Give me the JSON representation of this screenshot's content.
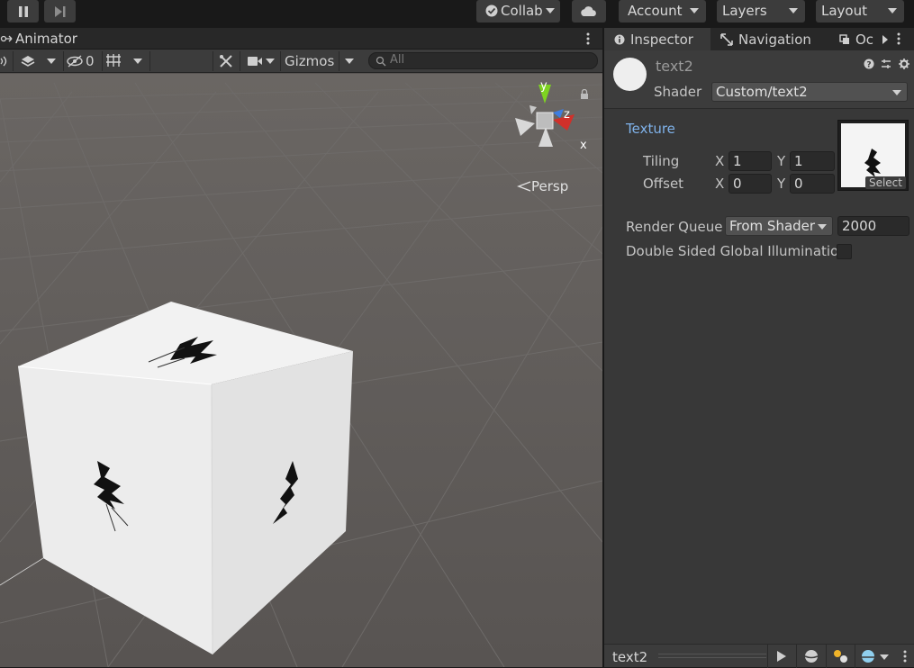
{
  "toolbar": {
    "collab_label": "Collab",
    "account_label": "Account",
    "layers_label": "Layers",
    "layout_label": "Layout"
  },
  "scene": {
    "tab_title": "Animator",
    "hidden_count": "0",
    "gizmos_label": "Gizmos",
    "search_placeholder": "All",
    "persp_label": "Persp",
    "axis_y": "y",
    "axis_z": "z",
    "axis_x": "x"
  },
  "inspector": {
    "tabs": [
      {
        "label": "Inspector"
      },
      {
        "label": "Navigation"
      },
      {
        "label": "Oc"
      }
    ],
    "material_name": "text2",
    "shader_label": "Shader",
    "shader_value": "Custom/text2",
    "texture_label": "Texture",
    "tiling_label": "Tiling",
    "offset_label": "Offset",
    "x_label": "X",
    "y_label": "Y",
    "tiling_x": "1",
    "tiling_y": "1",
    "offset_x": "0",
    "offset_y": "0",
    "select_label": "Select",
    "render_queue_label": "Render Queue",
    "render_queue_mode": "From Shader",
    "render_queue_value": "2000",
    "double_sided_label": "Double Sided Global Illumination",
    "double_sided_checked": false
  },
  "preview": {
    "name": "text2"
  },
  "colors": {
    "accent_blue": "#7fb2ea",
    "axis_y": "#7ed321",
    "axis_x": "#d0302a",
    "axis_z": "#3f7de0"
  }
}
